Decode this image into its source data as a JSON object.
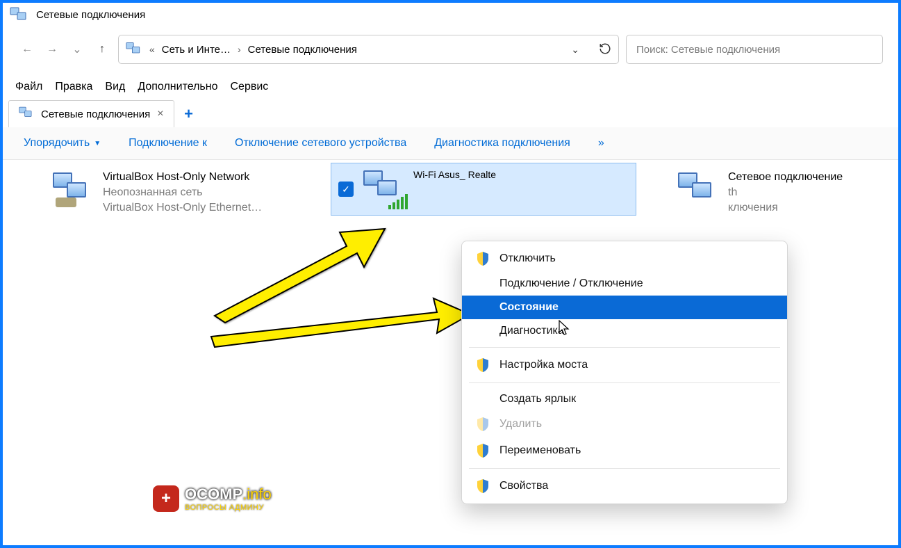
{
  "window": {
    "title": "Сетевые подключения"
  },
  "breadcrumb": {
    "seg1": "Сеть и Инте…",
    "seg2": "Сетевые подключения"
  },
  "search": {
    "placeholder": "Поиск: Сетевые подключения"
  },
  "menu": {
    "file": "Файл",
    "edit": "Правка",
    "view": "Вид",
    "extra": "Дополнительно",
    "service": "Сервис"
  },
  "tab": {
    "label": "Сетевые подключения"
  },
  "toolbar": {
    "organize": "Упорядочить",
    "connect": "Подключение к",
    "disable": "Отключение сетевого устройства",
    "diagnose": "Диагностика подключения",
    "overflow": "»"
  },
  "connections": {
    "vbox": {
      "title": "VirtualBox Host-Only Network",
      "sub1": "Неопознанная сеть",
      "sub2": "VirtualBox Host-Only Ethernet…"
    },
    "wifi": {
      "title": "Wi-Fi",
      "sub1": "Asus_",
      "sub2": "Realte"
    },
    "bt": {
      "title": "Сетевое подключение",
      "sub1": "th",
      "sub2": "ключения"
    }
  },
  "ctx": {
    "disable": "Отключить",
    "connect": "Подключение / Отключение",
    "status": "Состояние",
    "diag": "Диагностика",
    "bridge": "Настройка моста",
    "shortcut": "Создать ярлык",
    "delete": "Удалить",
    "rename": "Переименовать",
    "props": "Свойства"
  },
  "watermark": {
    "line1a": "OCOMP",
    "line1b": ".info",
    "line2": "ВОПРОСЫ АДМИНУ"
  }
}
